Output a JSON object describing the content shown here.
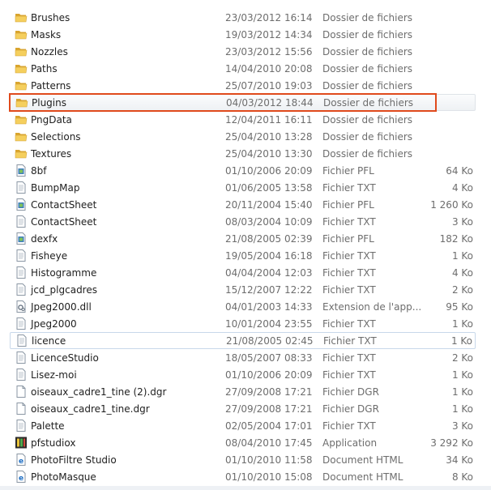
{
  "files": [
    {
      "name": "Brushes",
      "date": "23/03/2012 16:14",
      "type": "Dossier de fichiers",
      "size": "",
      "icon": "folder-icon"
    },
    {
      "name": "Masks",
      "date": "19/03/2012 14:34",
      "type": "Dossier de fichiers",
      "size": "",
      "icon": "folder-icon"
    },
    {
      "name": "Nozzles",
      "date": "23/03/2012 15:56",
      "type": "Dossier de fichiers",
      "size": "",
      "icon": "folder-icon"
    },
    {
      "name": "Paths",
      "date": "14/04/2010 20:08",
      "type": "Dossier de fichiers",
      "size": "",
      "icon": "folder-icon"
    },
    {
      "name": "Patterns",
      "date": "25/07/2010 19:03",
      "type": "Dossier de fichiers",
      "size": "",
      "icon": "folder-icon"
    },
    {
      "name": "Plugins",
      "date": "04/03/2012 18:44",
      "type": "Dossier de fichiers",
      "size": "",
      "icon": "folder-icon",
      "highlight": true
    },
    {
      "name": "PngData",
      "date": "12/04/2011 16:11",
      "type": "Dossier de fichiers",
      "size": "",
      "icon": "folder-icon"
    },
    {
      "name": "Selections",
      "date": "25/04/2010 13:28",
      "type": "Dossier de fichiers",
      "size": "",
      "icon": "folder-icon"
    },
    {
      "name": "Textures",
      "date": "25/04/2010 13:30",
      "type": "Dossier de fichiers",
      "size": "",
      "icon": "folder-icon"
    },
    {
      "name": "8bf",
      "date": "01/10/2006 20:09",
      "type": "Fichier PFL",
      "size": "64 Ko",
      "icon": "pfl-file-icon"
    },
    {
      "name": "BumpMap",
      "date": "01/06/2005 13:58",
      "type": "Fichier TXT",
      "size": "4 Ko",
      "icon": "text-file-icon"
    },
    {
      "name": "ContactSheet",
      "date": "20/11/2004 15:40",
      "type": "Fichier PFL",
      "size": "1 260 Ko",
      "icon": "pfl-file-icon"
    },
    {
      "name": "ContactSheet",
      "date": "08/03/2004 10:09",
      "type": "Fichier TXT",
      "size": "3 Ko",
      "icon": "text-file-icon"
    },
    {
      "name": "dexfx",
      "date": "21/08/2005 02:39",
      "type": "Fichier PFL",
      "size": "182 Ko",
      "icon": "pfl-file-icon"
    },
    {
      "name": "Fisheye",
      "date": "19/05/2004 16:18",
      "type": "Fichier TXT",
      "size": "1 Ko",
      "icon": "text-file-icon"
    },
    {
      "name": "Histogramme",
      "date": "04/04/2004 12:03",
      "type": "Fichier TXT",
      "size": "4 Ko",
      "icon": "text-file-icon"
    },
    {
      "name": "jcd_plgcadres",
      "date": "15/12/2007 12:22",
      "type": "Fichier TXT",
      "size": "2 Ko",
      "icon": "text-file-icon"
    },
    {
      "name": "Jpeg2000.dll",
      "date": "04/01/2003 14:33",
      "type": "Extension de l'app...",
      "size": "95 Ko",
      "icon": "dll-file-icon"
    },
    {
      "name": "Jpeg2000",
      "date": "10/01/2004 23:55",
      "type": "Fichier TXT",
      "size": "1 Ko",
      "icon": "text-file-icon"
    },
    {
      "name": "licence",
      "date": "21/08/2005 02:45",
      "type": "Fichier TXT",
      "size": "1 Ko",
      "icon": "text-file-icon",
      "focus": true
    },
    {
      "name": "LicenceStudio",
      "date": "18/05/2007 08:33",
      "type": "Fichier TXT",
      "size": "2 Ko",
      "icon": "text-file-icon"
    },
    {
      "name": "Lisez-moi",
      "date": "01/10/2006 20:09",
      "type": "Fichier TXT",
      "size": "1 Ko",
      "icon": "text-file-icon"
    },
    {
      "name": "oiseaux_cadre1_tine (2).dgr",
      "date": "27/09/2008 17:21",
      "type": "Fichier DGR",
      "size": "1 Ko",
      "icon": "generic-file-icon"
    },
    {
      "name": "oiseaux_cadre1_tine.dgr",
      "date": "27/09/2008 17:21",
      "type": "Fichier DGR",
      "size": "1 Ko",
      "icon": "generic-file-icon"
    },
    {
      "name": "Palette",
      "date": "02/05/2004 17:01",
      "type": "Fichier TXT",
      "size": "3 Ko",
      "icon": "text-file-icon"
    },
    {
      "name": "pfstudiox",
      "date": "08/04/2010 17:45",
      "type": "Application",
      "size": "3 292 Ko",
      "icon": "app-icon"
    },
    {
      "name": "PhotoFiltre Studio",
      "date": "01/10/2010 11:58",
      "type": "Document HTML",
      "size": "34 Ko",
      "icon": "html-file-icon"
    },
    {
      "name": "PhotoMasque",
      "date": "01/10/2010 15:08",
      "type": "Document HTML",
      "size": "8 Ko",
      "icon": "html-file-icon"
    }
  ]
}
